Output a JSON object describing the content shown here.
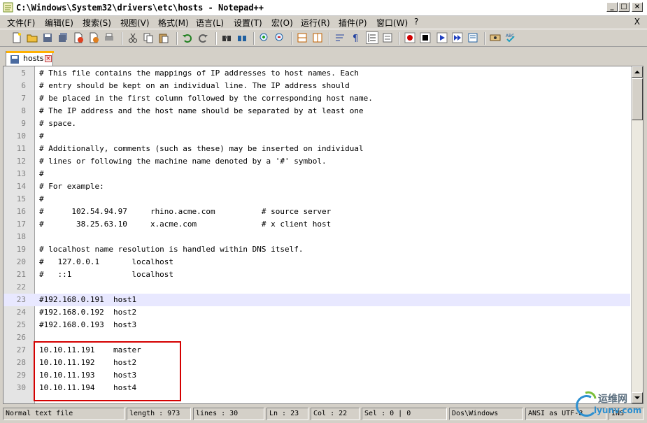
{
  "window": {
    "title": "C:\\Windows\\System32\\drivers\\etc\\hosts - Notepad++",
    "minimize": "_",
    "maximize": "□",
    "close": "×"
  },
  "menu": {
    "items": [
      "文件(F)",
      "编辑(E)",
      "搜索(S)",
      "视图(V)",
      "格式(M)",
      "语言(L)",
      "设置(T)",
      "宏(O)",
      "运行(R)",
      "插件(P)",
      "窗口(W)",
      "?"
    ],
    "close_label": "X"
  },
  "toolbar": {
    "icons": [
      "new-file-icon",
      "open-file-icon",
      "save-icon",
      "save-all-icon",
      "close-icon",
      "close-all-icon",
      "print-icon",
      "cut-icon",
      "copy-icon",
      "paste-icon",
      "undo-icon",
      "redo-icon",
      "find-icon",
      "replace-icon",
      "zoom-in-icon",
      "zoom-out-icon",
      "sync-vertical-icon",
      "sync-horizontal-icon",
      "word-wrap-icon",
      "show-all-chars-icon",
      "indent-guide-icon",
      "user-lang-icon",
      "record-macro-icon",
      "stop-record-icon",
      "play-macro-icon",
      "run-macro-multiple-icon",
      "save-macro-icon",
      "launch-browser-icon",
      "spell-check-icon"
    ]
  },
  "tab": {
    "label": "hosts",
    "close": "×"
  },
  "editor": {
    "current_line": 23,
    "lines": [
      {
        "n": "5",
        "text": "# This file contains the mappings of IP addresses to host names. Each"
      },
      {
        "n": "6",
        "text": "# entry should be kept on an individual line. The IP address should"
      },
      {
        "n": "7",
        "text": "# be placed in the first column followed by the corresponding host name."
      },
      {
        "n": "8",
        "text": "# The IP address and the host name should be separated by at least one"
      },
      {
        "n": "9",
        "text": "# space."
      },
      {
        "n": "10",
        "text": "#"
      },
      {
        "n": "11",
        "text": "# Additionally, comments (such as these) may be inserted on individual"
      },
      {
        "n": "12",
        "text": "# lines or following the machine name denoted by a '#' symbol."
      },
      {
        "n": "13",
        "text": "#"
      },
      {
        "n": "14",
        "text": "# For example:"
      },
      {
        "n": "15",
        "text": "#"
      },
      {
        "n": "16",
        "text": "#      102.54.94.97     rhino.acme.com          # source server"
      },
      {
        "n": "17",
        "text": "#       38.25.63.10     x.acme.com              # x client host"
      },
      {
        "n": "18",
        "text": ""
      },
      {
        "n": "19",
        "text": "# localhost name resolution is handled within DNS itself."
      },
      {
        "n": "20",
        "text": "#   127.0.0.1       localhost"
      },
      {
        "n": "21",
        "text": "#   ::1             localhost"
      },
      {
        "n": "22",
        "text": ""
      },
      {
        "n": "23",
        "text": "#192.168.0.191  host1"
      },
      {
        "n": "24",
        "text": "#192.168.0.192  host2"
      },
      {
        "n": "25",
        "text": "#192.168.0.193  host3"
      },
      {
        "n": "26",
        "text": ""
      },
      {
        "n": "27",
        "text": "10.10.11.191    master"
      },
      {
        "n": "28",
        "text": "10.10.11.192    host2"
      },
      {
        "n": "29",
        "text": "10.10.11.193    host3"
      },
      {
        "n": "30",
        "text": "10.10.11.194    host4"
      }
    ]
  },
  "status": {
    "file_type": "Normal text file",
    "length": "length : 973",
    "lines": "lines : 30",
    "ln": "Ln : 23",
    "col": "Col : 22",
    "sel": "Sel : 0 | 0",
    "eol": "Dos\\Windows",
    "encoding": "ANSI as UTF-8",
    "ins": "INS"
  },
  "watermark": {
    "cn": "运维网",
    "en": "iyunv.com"
  },
  "colors": {
    "highlight_box": "#d40000",
    "current_line_bg": "#e8e8ff",
    "gutter_bg": "#e4e4e4"
  }
}
